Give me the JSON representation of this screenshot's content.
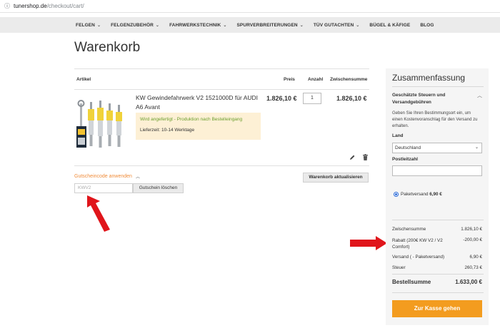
{
  "browser": {
    "url_host": "tunershop.de",
    "url_path": "/checkout/cart/"
  },
  "nav": [
    {
      "label": "FELGEN",
      "has_dropdown": true
    },
    {
      "label": "FELGENZUBEHÖR",
      "has_dropdown": true
    },
    {
      "label": "FAHRWERKSTECHNIK",
      "has_dropdown": true
    },
    {
      "label": "SPURVERBREITERUNGEN",
      "has_dropdown": true
    },
    {
      "label": "TÜV GUTACHTEN",
      "has_dropdown": true
    },
    {
      "label": "BÜGEL & KÄFIGE",
      "has_dropdown": false
    },
    {
      "label": "BLOG",
      "has_dropdown": false
    }
  ],
  "page_title": "Warenkorb",
  "cart": {
    "headers": {
      "item": "Artikel",
      "price": "Preis",
      "qty": "Anzahl",
      "subtotal": "Zwischensumme"
    },
    "item": {
      "name": "KW Gewindefahrwerk V2 1521000D für AUDI A6 Avant",
      "notice": "Wird angefertigt - Produktion nach Bestelleingang",
      "lead_time": "Lieferzeit: 10-14 Werktage",
      "price": "1.826,10 €",
      "qty": "1",
      "subtotal": "1.826,10 €"
    },
    "coupon_toggle": "Gutscheincode anwenden",
    "coupon_placeholder": "KWV2",
    "coupon_remove": "Gutschein löschen",
    "update_button": "Warenkorb aktualisieren"
  },
  "summary": {
    "title": "Zusammenfassung",
    "tax_heading": "Geschätzte Steuern und Versandgebühren",
    "tax_text": "Geben Sie Ihren Bestimmungsort ein, um einen Kostenvoranschlag für den Versand zu erhalten.",
    "country_label": "Land",
    "country_value": "Deutschland",
    "zip_label": "Postleitzahl",
    "shipping_option_name": "Paketversand",
    "shipping_option_price": "6,90 €",
    "rows": [
      {
        "label": "Zwischensumme",
        "value": "1.826,10 €"
      },
      {
        "label": "Rabatt (200€ KW V2 / V2 Comfort)",
        "value": "-200,00 €"
      },
      {
        "label": "Versand ( - Paketversand)",
        "value": "6,90 €"
      },
      {
        "label": "Steuer",
        "value": "260,73 €"
      }
    ],
    "total_label": "Bestellsumme",
    "total_value": "1.633,00 €",
    "checkout_button": "Zur Kasse gehen"
  },
  "colors": {
    "accent_orange": "#f39c1f",
    "annotation_red": "#e0151b",
    "notice_bg": "#fdf0d5",
    "notice_green": "#6a9e2d"
  }
}
